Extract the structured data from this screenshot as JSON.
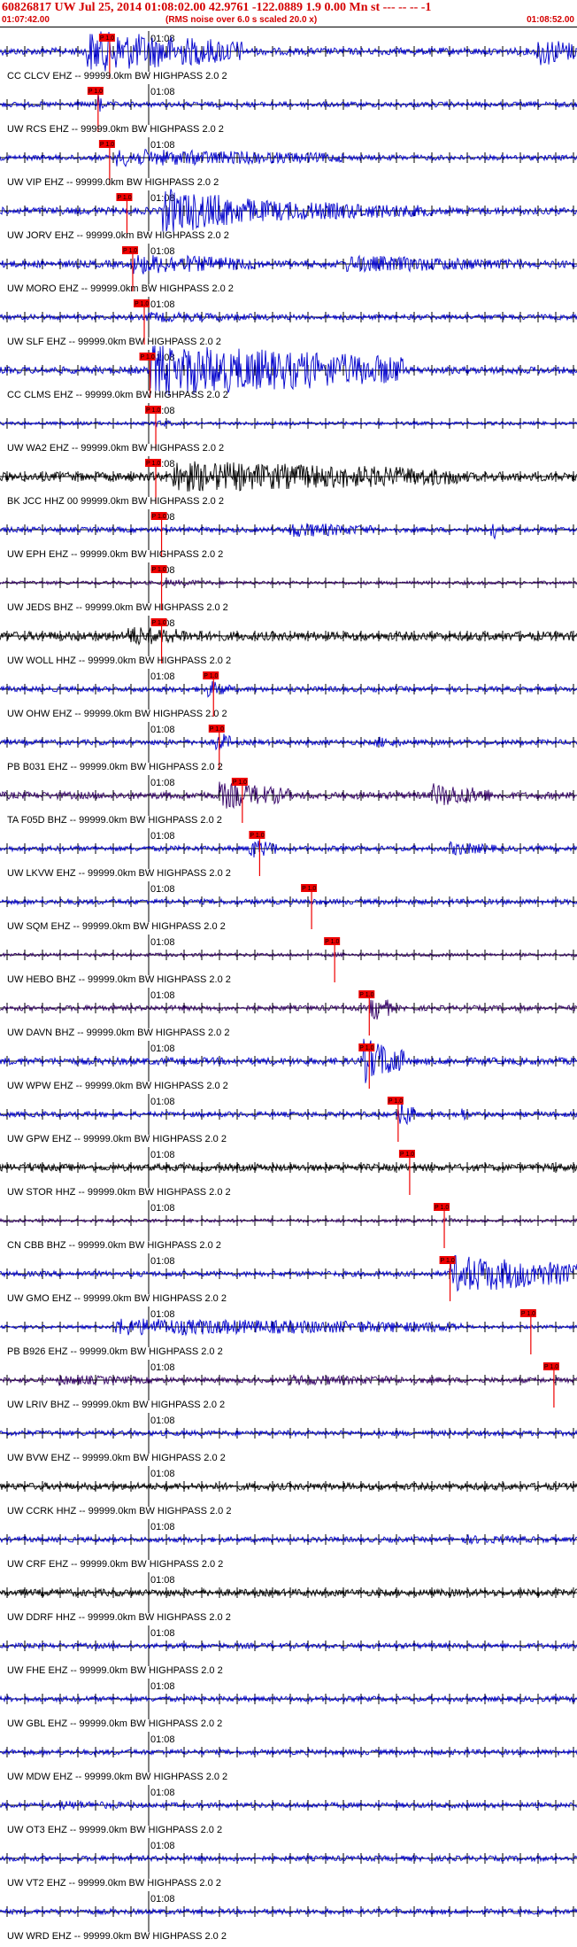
{
  "header": {
    "title": "60826817 UW Jul 25, 2014 01:08:02.00   42.9761 -122.0889  1.9 0.00 Mn st --- -- --  -1",
    "start_time": "01:07:42.00",
    "note": "(RMS noise over 6.0 s scaled 20.0 x)",
    "end_time": "01:08:52.00"
  },
  "minute_marker": "01:08",
  "pick_label": "P 1.0",
  "colors": {
    "header_text": "#d40000",
    "pick": "#ee0000"
  },
  "traces": [
    {
      "label": "CC CLCV EHZ -- 99999.0km BW  HIGHPASS  2.0  2",
      "color": "#0000cc",
      "amp": 4,
      "pick": 0.19,
      "bursts": [
        [
          0.15,
          0.42,
          24
        ],
        [
          0.93,
          1.0,
          18
        ]
      ]
    },
    {
      "label": "UW RCS EHZ -- 99999.0km BW  HIGHPASS  2.0  2",
      "color": "#0000cc",
      "amp": 3,
      "pick": 0.17,
      "bursts": [
        [
          0.17,
          0.18,
          14
        ]
      ]
    },
    {
      "label": "UW VIP EHZ -- 99999.0km BW  HIGHPASS  2.0  2",
      "color": "#0000cc",
      "amp": 3,
      "pick": 0.19,
      "bursts": [
        [
          0.2,
          0.6,
          10
        ]
      ]
    },
    {
      "label": "UW JORV EHZ -- 99999.0km BW  HIGHPASS  2.0  2",
      "color": "#0000cc",
      "amp": 4,
      "pick": 0.22,
      "bursts": [
        [
          0.28,
          0.45,
          26
        ],
        [
          0.45,
          0.75,
          12
        ]
      ]
    },
    {
      "label": "UW MORO EHZ -- 99999.0km BW  HIGHPASS  2.0  2",
      "color": "#0000cc",
      "amp": 4,
      "pick": 0.23,
      "bursts": [
        [
          0.23,
          0.45,
          12
        ],
        [
          0.6,
          0.9,
          10
        ]
      ]
    },
    {
      "label": "UW SLF EHZ -- 99999.0km BW  HIGHPASS  2.0  2",
      "color": "#0000cc",
      "amp": 3,
      "pick": 0.25,
      "bursts": [
        [
          0.25,
          0.5,
          6
        ]
      ]
    },
    {
      "label": "CC CLMS EHZ -- 99999.0km BW  HIGHPASS  2.0  2",
      "color": "#0000cc",
      "amp": 4,
      "pick": 0.26,
      "bursts": [
        [
          0.26,
          0.7,
          30
        ]
      ]
    },
    {
      "label": "UW WA2 EHZ -- 99999.0km BW  HIGHPASS  2.0  2",
      "color": "#0000cc",
      "amp": 2,
      "pick": 0.27,
      "bursts": [
        [
          0.27,
          0.3,
          5
        ]
      ]
    },
    {
      "label": "BK JCC HHZ 00 99999.0km BW  HIGHPASS  2.0  2",
      "color": "#000000",
      "amp": 5,
      "pick": 0.27,
      "bursts": [
        [
          0.3,
          0.8,
          18
        ]
      ]
    },
    {
      "label": "UW EPH EHZ -- 99999.0km BW  HIGHPASS  2.0  2",
      "color": "#0000cc",
      "amp": 3,
      "pick": 0.28,
      "bursts": [
        [
          0.5,
          0.65,
          9
        ],
        [
          0.85,
          0.86,
          16
        ]
      ]
    },
    {
      "label": "UW JEDS BHZ -- 99999.0km BW  HIGHPASS  2.0  2",
      "color": "#330066",
      "amp": 2,
      "pick": 0.28,
      "bursts": [
        [
          0.28,
          0.4,
          4
        ]
      ]
    },
    {
      "label": "UW WOLL HHZ -- 99999.0km BW  HIGHPASS  2.0  2",
      "color": "#000000",
      "amp": 5,
      "pick": 0.28,
      "bursts": [
        [
          0.22,
          0.35,
          12
        ]
      ]
    },
    {
      "label": "UW OHW EHZ -- 99999.0km BW  HIGHPASS  2.0  2",
      "color": "#0000cc",
      "amp": 3,
      "pick": 0.37,
      "bursts": [
        [
          0.36,
          0.4,
          10
        ]
      ]
    },
    {
      "label": "PB B031 EHZ -- 99999.0km BW  HIGHPASS  2.0  2",
      "color": "#0000cc",
      "amp": 3,
      "pick": 0.38,
      "bursts": [
        [
          0.37,
          0.4,
          14
        ],
        [
          0.65,
          0.7,
          7
        ]
      ]
    },
    {
      "label": "TA F05D BHZ -- 99999.0km BW  HIGHPASS  2.0  2",
      "color": "#330066",
      "amp": 4,
      "pick": 0.42,
      "bursts": [
        [
          0.38,
          0.5,
          16
        ],
        [
          0.75,
          0.85,
          14
        ]
      ]
    },
    {
      "label": "UW LKVW EHZ -- 99999.0km BW  HIGHPASS  2.0  2",
      "color": "#0000cc",
      "amp": 3,
      "pick": 0.45,
      "bursts": [
        [
          0.43,
          0.48,
          12
        ],
        [
          0.78,
          0.86,
          8
        ]
      ]
    },
    {
      "label": "UW SQM EHZ -- 99999.0km BW  HIGHPASS  2.0  2",
      "color": "#0000cc",
      "amp": 3,
      "pick": 0.54,
      "bursts": [
        [
          0.54,
          0.58,
          4
        ]
      ]
    },
    {
      "label": "UW HEBO BHZ -- 99999.0km BW  HIGHPASS  2.0  2",
      "color": "#330066",
      "amp": 2,
      "pick": 0.58,
      "bursts": [
        [
          0.58,
          0.62,
          3
        ]
      ]
    },
    {
      "label": "UW DAVN BHZ -- 99999.0km BW  HIGHPASS  2.0  2",
      "color": "#330066",
      "amp": 3,
      "pick": 0.64,
      "bursts": [
        [
          0.64,
          0.68,
          16
        ]
      ]
    },
    {
      "label": "UW WPW EHZ -- 99999.0km BW  HIGHPASS  2.0  2",
      "color": "#0000cc",
      "amp": 4,
      "pick": 0.64,
      "bursts": [
        [
          0.63,
          0.7,
          26
        ]
      ]
    },
    {
      "label": "UW GPW EHZ -- 99999.0km BW  HIGHPASS  2.0  2",
      "color": "#0000cc",
      "amp": 3,
      "pick": 0.69,
      "bursts": [
        [
          0.69,
          0.72,
          18
        ],
        [
          0.8,
          0.81,
          10
        ]
      ]
    },
    {
      "label": "UW STOR HHZ -- 99999.0km BW  HIGHPASS  2.0  2",
      "color": "#000000",
      "amp": 4,
      "pick": 0.71,
      "bursts": [
        [
          0.05,
          0.1,
          6
        ],
        [
          0.95,
          1.0,
          6
        ]
      ]
    },
    {
      "label": "CN CBB BHZ -- 99999.0km BW  HIGHPASS  2.0  2",
      "color": "#330066",
      "amp": 2,
      "pick": 0.77,
      "bursts": [
        [
          0.77,
          0.8,
          3
        ]
      ]
    },
    {
      "label": "UW GMO EHZ -- 99999.0km BW  HIGHPASS  2.0  2",
      "color": "#0000cc",
      "amp": 3,
      "pick": 0.78,
      "bursts": [
        [
          0.78,
          1.0,
          22
        ]
      ]
    },
    {
      "label": "PB B926 EHZ -- 99999.0km BW  HIGHPASS  2.0  2",
      "color": "#0000cc",
      "amp": 2,
      "pick": 0.92,
      "bursts": [
        [
          0.2,
          0.8,
          10
        ]
      ]
    },
    {
      "label": "UW LRIV BHZ -- 99999.0km BW  HIGHPASS  2.0  2",
      "color": "#330066",
      "amp": 3,
      "pick": 0.96,
      "bursts": [
        [
          0.1,
          0.3,
          6
        ],
        [
          0.5,
          0.8,
          6
        ]
      ]
    },
    {
      "label": "UW BVW EHZ -- 99999.0km BW  HIGHPASS  2.0  2",
      "color": "#0000cc",
      "amp": 3,
      "pick": null,
      "bursts": []
    },
    {
      "label": "UW CCRK HHZ -- 99999.0km BW  HIGHPASS  2.0  2",
      "color": "#000000",
      "amp": 4,
      "pick": null,
      "bursts": []
    },
    {
      "label": "UW CRF EHZ -- 99999.0km BW  HIGHPASS  2.0  2",
      "color": "#0000cc",
      "amp": 3,
      "pick": null,
      "bursts": [
        [
          0.8,
          1.0,
          5
        ]
      ]
    },
    {
      "label": "UW DDRF HHZ -- 99999.0km BW  HIGHPASS  2.0  2",
      "color": "#000000",
      "amp": 4,
      "pick": null,
      "bursts": []
    },
    {
      "label": "UW FHE EHZ -- 99999.0km BW  HIGHPASS  2.0  2",
      "color": "#0000cc",
      "amp": 3,
      "pick": null,
      "bursts": []
    },
    {
      "label": "UW GBL EHZ -- 99999.0km BW  HIGHPASS  2.0  2",
      "color": "#0000cc",
      "amp": 3,
      "pick": null,
      "bursts": []
    },
    {
      "label": "UW MDW EHZ -- 99999.0km BW  HIGHPASS  2.0  2",
      "color": "#0000cc",
      "amp": 3,
      "pick": null,
      "bursts": []
    },
    {
      "label": "UW OT3 EHZ -- 99999.0km BW  HIGHPASS  2.0  2",
      "color": "#0000cc",
      "amp": 3,
      "pick": null,
      "bursts": [
        [
          0.1,
          0.3,
          5
        ]
      ]
    },
    {
      "label": "UW VT2 EHZ -- 99999.0km BW  HIGHPASS  2.0  2",
      "color": "#0000cc",
      "amp": 3,
      "pick": null,
      "bursts": []
    },
    {
      "label": "UW WRD EHZ -- 99999.0km BW  HIGHPASS  2.0  2",
      "color": "#0000cc",
      "amp": 3,
      "pick": null,
      "bursts": []
    }
  ]
}
